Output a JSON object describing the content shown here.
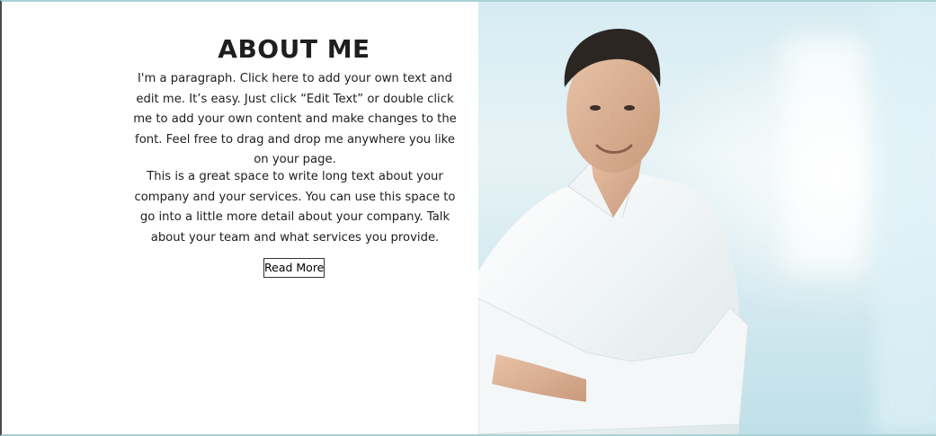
{
  "about": {
    "title": "ABOUT ME",
    "paragraph_1": "I'm a paragraph. Click here to add your own text and edit me. It’s easy. Just click “Edit Text” or double click me to add your own content and make changes to the font. Feel free to drag and drop me anywhere you like on your page.",
    "paragraph_2": "This is a great space to write long text about your company and your services. You can use this space to go into a little more detail about your company. Talk about your team and what services you provide.",
    "read_more_label": "Read More"
  },
  "colors": {
    "frame_top": "#a9d3d6",
    "frame_left": "#4a4a4a",
    "text": "#1e1e1e",
    "photo_background": "#d6ecf2",
    "shirt": "#f7f9fa"
  },
  "icons": {
    "portrait": "person-portrait"
  }
}
